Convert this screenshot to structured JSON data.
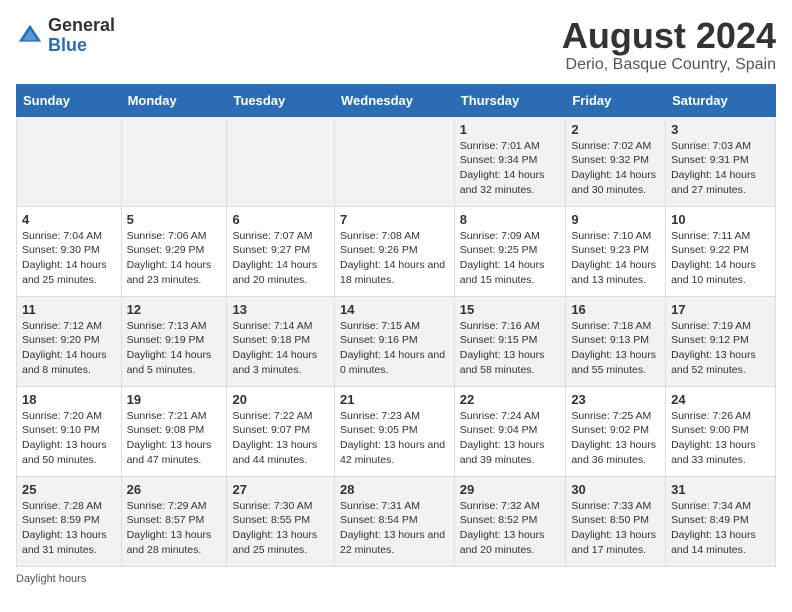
{
  "logo": {
    "text_general": "General",
    "text_blue": "Blue"
  },
  "title": "August 2024",
  "subtitle": "Derio, Basque Country, Spain",
  "days_of_week": [
    "Sunday",
    "Monday",
    "Tuesday",
    "Wednesday",
    "Thursday",
    "Friday",
    "Saturday"
  ],
  "weeks": [
    [
      {
        "day": "",
        "sunrise": "",
        "sunset": "",
        "daylight": ""
      },
      {
        "day": "",
        "sunrise": "",
        "sunset": "",
        "daylight": ""
      },
      {
        "day": "",
        "sunrise": "",
        "sunset": "",
        "daylight": ""
      },
      {
        "day": "",
        "sunrise": "",
        "sunset": "",
        "daylight": ""
      },
      {
        "day": "1",
        "sunrise": "Sunrise: 7:01 AM",
        "sunset": "Sunset: 9:34 PM",
        "daylight": "Daylight: 14 hours and 32 minutes."
      },
      {
        "day": "2",
        "sunrise": "Sunrise: 7:02 AM",
        "sunset": "Sunset: 9:32 PM",
        "daylight": "Daylight: 14 hours and 30 minutes."
      },
      {
        "day": "3",
        "sunrise": "Sunrise: 7:03 AM",
        "sunset": "Sunset: 9:31 PM",
        "daylight": "Daylight: 14 hours and 27 minutes."
      }
    ],
    [
      {
        "day": "4",
        "sunrise": "Sunrise: 7:04 AM",
        "sunset": "Sunset: 9:30 PM",
        "daylight": "Daylight: 14 hours and 25 minutes."
      },
      {
        "day": "5",
        "sunrise": "Sunrise: 7:06 AM",
        "sunset": "Sunset: 9:29 PM",
        "daylight": "Daylight: 14 hours and 23 minutes."
      },
      {
        "day": "6",
        "sunrise": "Sunrise: 7:07 AM",
        "sunset": "Sunset: 9:27 PM",
        "daylight": "Daylight: 14 hours and 20 minutes."
      },
      {
        "day": "7",
        "sunrise": "Sunrise: 7:08 AM",
        "sunset": "Sunset: 9:26 PM",
        "daylight": "Daylight: 14 hours and 18 minutes."
      },
      {
        "day": "8",
        "sunrise": "Sunrise: 7:09 AM",
        "sunset": "Sunset: 9:25 PM",
        "daylight": "Daylight: 14 hours and 15 minutes."
      },
      {
        "day": "9",
        "sunrise": "Sunrise: 7:10 AM",
        "sunset": "Sunset: 9:23 PM",
        "daylight": "Daylight: 14 hours and 13 minutes."
      },
      {
        "day": "10",
        "sunrise": "Sunrise: 7:11 AM",
        "sunset": "Sunset: 9:22 PM",
        "daylight": "Daylight: 14 hours and 10 minutes."
      }
    ],
    [
      {
        "day": "11",
        "sunrise": "Sunrise: 7:12 AM",
        "sunset": "Sunset: 9:20 PM",
        "daylight": "Daylight: 14 hours and 8 minutes."
      },
      {
        "day": "12",
        "sunrise": "Sunrise: 7:13 AM",
        "sunset": "Sunset: 9:19 PM",
        "daylight": "Daylight: 14 hours and 5 minutes."
      },
      {
        "day": "13",
        "sunrise": "Sunrise: 7:14 AM",
        "sunset": "Sunset: 9:18 PM",
        "daylight": "Daylight: 14 hours and 3 minutes."
      },
      {
        "day": "14",
        "sunrise": "Sunrise: 7:15 AM",
        "sunset": "Sunset: 9:16 PM",
        "daylight": "Daylight: 14 hours and 0 minutes."
      },
      {
        "day": "15",
        "sunrise": "Sunrise: 7:16 AM",
        "sunset": "Sunset: 9:15 PM",
        "daylight": "Daylight: 13 hours and 58 minutes."
      },
      {
        "day": "16",
        "sunrise": "Sunrise: 7:18 AM",
        "sunset": "Sunset: 9:13 PM",
        "daylight": "Daylight: 13 hours and 55 minutes."
      },
      {
        "day": "17",
        "sunrise": "Sunrise: 7:19 AM",
        "sunset": "Sunset: 9:12 PM",
        "daylight": "Daylight: 13 hours and 52 minutes."
      }
    ],
    [
      {
        "day": "18",
        "sunrise": "Sunrise: 7:20 AM",
        "sunset": "Sunset: 9:10 PM",
        "daylight": "Daylight: 13 hours and 50 minutes."
      },
      {
        "day": "19",
        "sunrise": "Sunrise: 7:21 AM",
        "sunset": "Sunset: 9:08 PM",
        "daylight": "Daylight: 13 hours and 47 minutes."
      },
      {
        "day": "20",
        "sunrise": "Sunrise: 7:22 AM",
        "sunset": "Sunset: 9:07 PM",
        "daylight": "Daylight: 13 hours and 44 minutes."
      },
      {
        "day": "21",
        "sunrise": "Sunrise: 7:23 AM",
        "sunset": "Sunset: 9:05 PM",
        "daylight": "Daylight: 13 hours and 42 minutes."
      },
      {
        "day": "22",
        "sunrise": "Sunrise: 7:24 AM",
        "sunset": "Sunset: 9:04 PM",
        "daylight": "Daylight: 13 hours and 39 minutes."
      },
      {
        "day": "23",
        "sunrise": "Sunrise: 7:25 AM",
        "sunset": "Sunset: 9:02 PM",
        "daylight": "Daylight: 13 hours and 36 minutes."
      },
      {
        "day": "24",
        "sunrise": "Sunrise: 7:26 AM",
        "sunset": "Sunset: 9:00 PM",
        "daylight": "Daylight: 13 hours and 33 minutes."
      }
    ],
    [
      {
        "day": "25",
        "sunrise": "Sunrise: 7:28 AM",
        "sunset": "Sunset: 8:59 PM",
        "daylight": "Daylight: 13 hours and 31 minutes."
      },
      {
        "day": "26",
        "sunrise": "Sunrise: 7:29 AM",
        "sunset": "Sunset: 8:57 PM",
        "daylight": "Daylight: 13 hours and 28 minutes."
      },
      {
        "day": "27",
        "sunrise": "Sunrise: 7:30 AM",
        "sunset": "Sunset: 8:55 PM",
        "daylight": "Daylight: 13 hours and 25 minutes."
      },
      {
        "day": "28",
        "sunrise": "Sunrise: 7:31 AM",
        "sunset": "Sunset: 8:54 PM",
        "daylight": "Daylight: 13 hours and 22 minutes."
      },
      {
        "day": "29",
        "sunrise": "Sunrise: 7:32 AM",
        "sunset": "Sunset: 8:52 PM",
        "daylight": "Daylight: 13 hours and 20 minutes."
      },
      {
        "day": "30",
        "sunrise": "Sunrise: 7:33 AM",
        "sunset": "Sunset: 8:50 PM",
        "daylight": "Daylight: 13 hours and 17 minutes."
      },
      {
        "day": "31",
        "sunrise": "Sunrise: 7:34 AM",
        "sunset": "Sunset: 8:49 PM",
        "daylight": "Daylight: 13 hours and 14 minutes."
      }
    ]
  ],
  "footer": {
    "daylight_label": "Daylight hours"
  }
}
